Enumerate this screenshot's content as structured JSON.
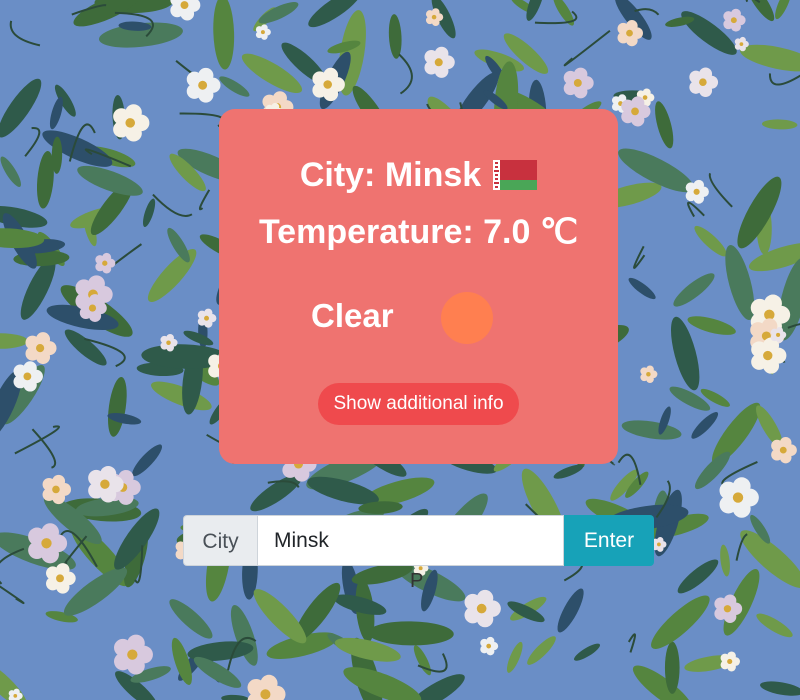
{
  "weather_card": {
    "city_line": "City: Minsk",
    "country_flag_icon": "belarus-flag",
    "temperature_line": "Temperature: 7.0",
    "temperature_unit": "℃",
    "condition": "Clear",
    "condition_icon": "sun-circle",
    "additional_info_button": "Show additional info"
  },
  "search": {
    "label": "City",
    "value": "Minsk",
    "button": "Enter"
  },
  "stray_text": "P",
  "colors": {
    "card": "#ef7370",
    "button": "#ef4a4d",
    "sun": "#ff7f50",
    "enter_button": "#17a2b8",
    "background": "#6b8fc8"
  }
}
